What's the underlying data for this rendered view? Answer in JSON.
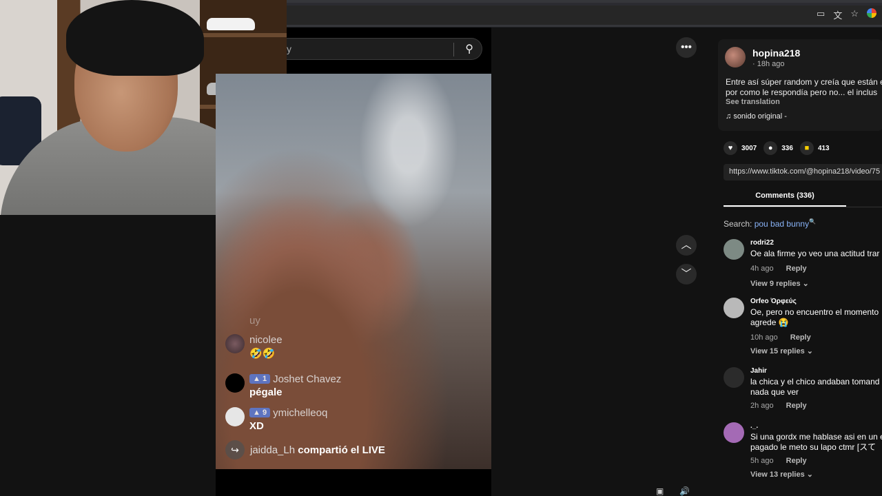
{
  "browser": {
    "icons": [
      "cast-icon",
      "translate-icon",
      "star-icon"
    ]
  },
  "video_search": {
    "query": "y"
  },
  "live_chat": {
    "faded_line": "uy",
    "messages": [
      {
        "name": "nicolee",
        "level": "",
        "text": "🤣🤣"
      },
      {
        "name": "Joshet Chavez",
        "level": "1",
        "text": "pégale"
      },
      {
        "name": "ymichelleoq",
        "level": "9",
        "text": "XD"
      }
    ],
    "share_user": "jaidda_Lh",
    "share_text": " compartió el LIVE"
  },
  "post": {
    "username": "hopina218",
    "time": "· 18h ago",
    "description_line1": "Entre así súper random y creía que están e",
    "description_line2": "por como le respondía pero no... el inclus",
    "see_translation": "See translation",
    "sound": "sonido original -",
    "likes": "3007",
    "comments": "336",
    "saves": "413",
    "link": "https://www.tiktok.com/@hopina218/video/75"
  },
  "comments_tab": {
    "label": "Comments (336)",
    "search_prefix": "Search: ",
    "search_term": "pou bad bunny",
    "search_icon": "🔍"
  },
  "comments": [
    {
      "user": "rodri22",
      "text_line1": "Oe ala firme yo veo una actitud trar",
      "text_line2": "",
      "time": "4h ago",
      "reply": "Reply",
      "view": "View 9 replies",
      "avatar_color": "#7d8a84"
    },
    {
      "user": "Orfeo Ὀρφεύς",
      "text_line1": "Oe, pero no encuentro el momento",
      "text_line2": "agrede 😭",
      "time": "10h ago",
      "reply": "Reply",
      "view": "View 15 replies",
      "avatar_color": "#b9b9b9"
    },
    {
      "user": "Jahir",
      "text_line1": "la chica y el chico andaban tomand",
      "text_line2": "nada que ver",
      "time": "2h ago",
      "reply": "Reply",
      "view": "",
      "avatar_color": "#2b2b2b"
    },
    {
      "user": "._.",
      "text_line1": "Si una gordx me hablase asi en un e",
      "text_line2": "pagado le meto su lapo ctmr [スて",
      "time": "5h ago",
      "reply": "Reply",
      "view": "View 13 replies",
      "avatar_color": "#a46ab5"
    }
  ]
}
